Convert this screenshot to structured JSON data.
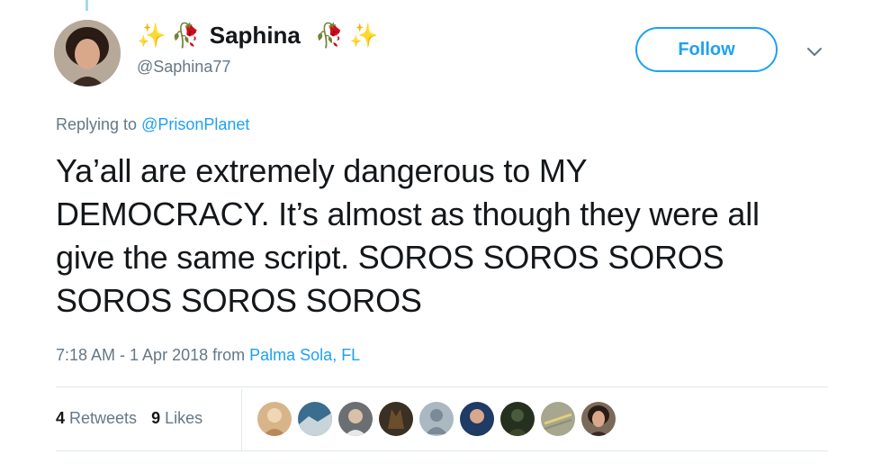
{
  "author": {
    "display_name": "Saphina",
    "handle": "@Saphina77",
    "name_decor_left": [
      "✨",
      "🥀"
    ],
    "name_decor_right": [
      "🥀",
      "✨"
    ]
  },
  "actions": {
    "follow_label": "Follow",
    "more_icon": "chevron-down-icon"
  },
  "reply": {
    "prefix": "Replying to ",
    "target": "@PrisonPlanet"
  },
  "tweet": {
    "text": "Ya’all are extremely dangerous to MY DEMOCRACY. It’s almost as though they were all give the same script. SOROS SOROS SOROS SOROS SOROS SOROS",
    "timestamp": "7:18 AM - 1 Apr 2018",
    "from_label": " from ",
    "location": "Palma Sola, FL"
  },
  "stats": {
    "retweets_count": "4",
    "retweets_label": " Retweets",
    "likes_count": "9",
    "likes_label": " Likes"
  },
  "colors": {
    "accent": "#1da1f2",
    "secondary_text": "#657786",
    "primary_text": "#14171a",
    "divider": "#e1e8ed"
  }
}
